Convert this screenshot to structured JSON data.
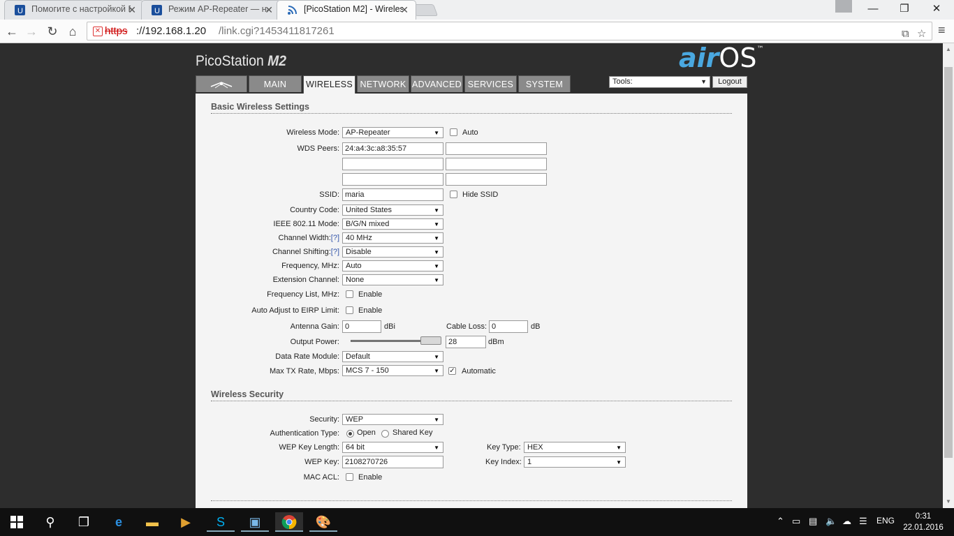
{
  "browser": {
    "tabs": [
      {
        "title": "Помогите с настройкой P"
      },
      {
        "title": "Режим AP-Repeater — на"
      },
      {
        "title": "[PicoStation M2] - Wireles"
      }
    ],
    "url_scheme": "https",
    "url_host": "://192.168.1.20",
    "url_path": "/link.cgi?1453411817261"
  },
  "header": {
    "product": "PicoStation",
    "model": "M2",
    "logo_air": "air",
    "logo_os": "OS",
    "logo_tm": "™",
    "tabs": [
      "MAIN",
      "WIRELESS",
      "NETWORK",
      "ADVANCED",
      "SERVICES",
      "SYSTEM"
    ],
    "tools_label": "Tools:",
    "logout_label": "Logout"
  },
  "basic": {
    "title": "Basic Wireless Settings",
    "wireless_mode_label": "Wireless Mode:",
    "wireless_mode": "AP-Repeater",
    "auto_label": "Auto",
    "wds_label": "WDS Peers:",
    "wds_peer1": "24:a4:3c:a8:35:57",
    "ssid_label": "SSID:",
    "ssid": "maria",
    "hide_ssid_label": "Hide SSID",
    "country_label": "Country Code:",
    "country": "United States",
    "ieee_label": "IEEE 802.11 Mode:",
    "ieee": "B/G/N mixed",
    "chwidth_label": "Channel Width:",
    "chwidth": "40 MHz",
    "chshift_label": "Channel Shifting:",
    "chshift": "Disable",
    "help": "[?]",
    "freq_label": "Frequency, MHz:",
    "freq": "Auto",
    "ext_label": "Extension Channel:",
    "ext": "None",
    "freqlist_label": "Frequency List, MHz:",
    "enable_label": "Enable",
    "eirp_label": "Auto Adjust to EIRP Limit:",
    "antenna_label": "Antenna Gain:",
    "antenna": "0",
    "dbi": "dBi",
    "cable_label": "Cable Loss:",
    "cable": "0",
    "db": "dB",
    "output_label": "Output Power:",
    "output": "28",
    "dbm": "dBm",
    "datarate_label": "Data Rate Module:",
    "datarate": "Default",
    "maxtx_label": "Max TX Rate, Mbps:",
    "maxtx": "MCS 7 - 150",
    "automatic_label": "Automatic"
  },
  "security": {
    "title": "Wireless Security",
    "security_label": "Security:",
    "security": "WEP",
    "auth_label": "Authentication Type:",
    "open_label": "Open",
    "shared_label": "Shared Key",
    "keylen_label": "WEP Key Length:",
    "keylen": "64 bit",
    "keytype_label": "Key Type:",
    "keytype": "HEX",
    "wepkey_label": "WEP Key:",
    "wepkey": "2108270726",
    "keyindex_label": "Key Index:",
    "keyindex": "1",
    "macacl_label": "MAC ACL:",
    "enable_label": "Enable"
  },
  "taskbar": {
    "lang": "ENG",
    "time": "0:31",
    "date": "22.01.2016"
  },
  "colors": {
    "accent": "#4aa8e0",
    "page_bg": "#2d2d2d",
    "panel_bg": "#f4f4f4"
  }
}
